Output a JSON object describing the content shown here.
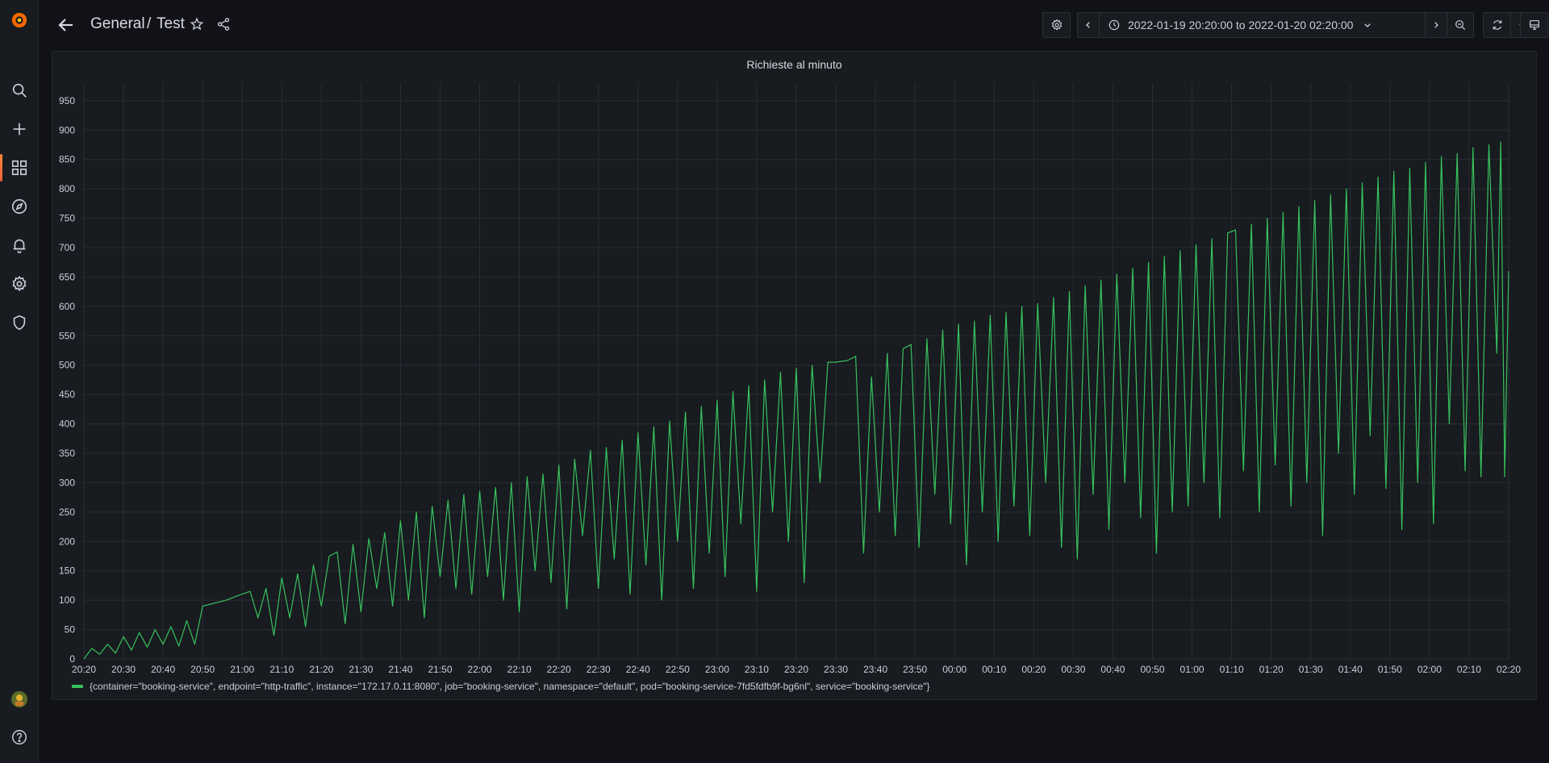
{
  "breadcrumb": {
    "folder": "General",
    "separator": "/",
    "dashboard": "Test"
  },
  "time_range": {
    "label": "2022-01-19 20:20:00 to 2022-01-20 02:20:00"
  },
  "panel": {
    "title": "Richieste al minuto"
  },
  "colors": {
    "series": "#37c15e",
    "brand_orange": "#f55f3e",
    "background": "#111217",
    "panel_bg": "#181b1f"
  },
  "icons": {
    "sidebar": [
      "grafana-logo-icon",
      "search-icon",
      "plus-icon",
      "dashboards-icon",
      "explore-compass-icon",
      "bell-icon",
      "gear-icon",
      "shield-icon",
      "avatar",
      "help-icon"
    ],
    "toolbar": [
      "arrow-left-icon",
      "star-icon",
      "share-icon",
      "gear-icon",
      "chevron-left-icon",
      "clock-icon",
      "chevron-down-icon",
      "chevron-right-icon",
      "zoom-out-icon",
      "refresh-icon",
      "monitor-icon"
    ]
  },
  "chart_data": {
    "type": "line",
    "title": "Richieste al minuto",
    "xlabel": "",
    "ylabel": "",
    "ylim": [
      0,
      980
    ],
    "yticks": [
      "0",
      "50",
      "100",
      "150",
      "200",
      "250",
      "300",
      "350",
      "400",
      "450",
      "500",
      "550",
      "600",
      "650",
      "700",
      "750",
      "800",
      "850",
      "900",
      "950"
    ],
    "xlim": [
      "2022-01-19 20:20",
      "2022-01-20 02:20"
    ],
    "xticks": [
      "20:20",
      "20:30",
      "20:40",
      "20:50",
      "21:00",
      "21:10",
      "21:20",
      "21:30",
      "21:40",
      "21:50",
      "22:00",
      "22:10",
      "22:20",
      "22:30",
      "22:40",
      "22:50",
      "23:00",
      "23:10",
      "23:20",
      "23:30",
      "23:40",
      "23:50",
      "00:00",
      "00:10",
      "00:20",
      "00:30",
      "00:40",
      "00:50",
      "01:00",
      "01:10",
      "01:20",
      "01:30",
      "01:40",
      "01:50",
      "02:00",
      "02:10",
      "02:20"
    ],
    "grid": true,
    "legend": "bottom",
    "series": [
      {
        "name": "{container=\"booking-service\", endpoint=\"http-traffic\", instance=\"172.17.0.11:8080\", job=\"booking-service\", namespace=\"default\", pod=\"booking-service-7fd5fdfb9f-bg6nl\", service=\"booking-service\"}",
        "color": "#37c15e",
        "points": [
          [
            "2022-01-19 20:20",
            0
          ],
          [
            "2022-01-19 20:22",
            18
          ],
          [
            "2022-01-19 20:24",
            8
          ],
          [
            "2022-01-19 20:26",
            25
          ],
          [
            "2022-01-19 20:28",
            10
          ],
          [
            "2022-01-19 20:30",
            38
          ],
          [
            "2022-01-19 20:32",
            15
          ],
          [
            "2022-01-19 20:34",
            45
          ],
          [
            "2022-01-19 20:36",
            20
          ],
          [
            "2022-01-19 20:38",
            50
          ],
          [
            "2022-01-19 20:40",
            25
          ],
          [
            "2022-01-19 20:42",
            55
          ],
          [
            "2022-01-19 20:44",
            22
          ],
          [
            "2022-01-19 20:46",
            65
          ],
          [
            "2022-01-19 20:48",
            25
          ],
          [
            "2022-01-19 20:50",
            90
          ],
          [
            "2022-01-19 20:53",
            95
          ],
          [
            "2022-01-19 20:56",
            100
          ],
          [
            "2022-01-19 20:59",
            108
          ],
          [
            "2022-01-19 21:02",
            115
          ],
          [
            "2022-01-19 21:04",
            70
          ],
          [
            "2022-01-19 21:06",
            120
          ],
          [
            "2022-01-19 21:08",
            40
          ],
          [
            "2022-01-19 21:10",
            138
          ],
          [
            "2022-01-19 21:12",
            70
          ],
          [
            "2022-01-19 21:14",
            145
          ],
          [
            "2022-01-19 21:16",
            55
          ],
          [
            "2022-01-19 21:18",
            160
          ],
          [
            "2022-01-19 21:20",
            90
          ],
          [
            "2022-01-19 21:22",
            175
          ],
          [
            "2022-01-19 21:24",
            182
          ],
          [
            "2022-01-19 21:26",
            60
          ],
          [
            "2022-01-19 21:28",
            195
          ],
          [
            "2022-01-19 21:30",
            80
          ],
          [
            "2022-01-19 21:32",
            205
          ],
          [
            "2022-01-19 21:34",
            120
          ],
          [
            "2022-01-19 21:36",
            215
          ],
          [
            "2022-01-19 21:38",
            90
          ],
          [
            "2022-01-19 21:40",
            235
          ],
          [
            "2022-01-19 21:42",
            100
          ],
          [
            "2022-01-19 21:44",
            250
          ],
          [
            "2022-01-19 21:46",
            70
          ],
          [
            "2022-01-19 21:48",
            260
          ],
          [
            "2022-01-19 21:50",
            140
          ],
          [
            "2022-01-19 21:52",
            270
          ],
          [
            "2022-01-19 21:54",
            120
          ],
          [
            "2022-01-19 21:56",
            280
          ],
          [
            "2022-01-19 21:58",
            110
          ],
          [
            "2022-01-19 22:00",
            285
          ],
          [
            "2022-01-19 22:02",
            140
          ],
          [
            "2022-01-19 22:04",
            292
          ],
          [
            "2022-01-19 22:06",
            100
          ],
          [
            "2022-01-19 22:08",
            300
          ],
          [
            "2022-01-19 22:10",
            80
          ],
          [
            "2022-01-19 22:12",
            310
          ],
          [
            "2022-01-19 22:14",
            150
          ],
          [
            "2022-01-19 22:16",
            315
          ],
          [
            "2022-01-19 22:18",
            130
          ],
          [
            "2022-01-19 22:20",
            330
          ],
          [
            "2022-01-19 22:22",
            85
          ],
          [
            "2022-01-19 22:24",
            340
          ],
          [
            "2022-01-19 22:26",
            210
          ],
          [
            "2022-01-19 22:28",
            355
          ],
          [
            "2022-01-19 22:30",
            120
          ],
          [
            "2022-01-19 22:32",
            360
          ],
          [
            "2022-01-19 22:34",
            170
          ],
          [
            "2022-01-19 22:36",
            372
          ],
          [
            "2022-01-19 22:38",
            110
          ],
          [
            "2022-01-19 22:40",
            385
          ],
          [
            "2022-01-19 22:42",
            160
          ],
          [
            "2022-01-19 22:44",
            395
          ],
          [
            "2022-01-19 22:46",
            100
          ],
          [
            "2022-01-19 22:48",
            405
          ],
          [
            "2022-01-19 22:50",
            200
          ],
          [
            "2022-01-19 22:52",
            420
          ],
          [
            "2022-01-19 22:54",
            120
          ],
          [
            "2022-01-19 22:56",
            430
          ],
          [
            "2022-01-19 22:58",
            180
          ],
          [
            "2022-01-19 23:00",
            440
          ],
          [
            "2022-01-19 23:02",
            140
          ],
          [
            "2022-01-19 23:04",
            455
          ],
          [
            "2022-01-19 23:06",
            230
          ],
          [
            "2022-01-19 23:08",
            465
          ],
          [
            "2022-01-19 23:10",
            115
          ],
          [
            "2022-01-19 23:12",
            475
          ],
          [
            "2022-01-19 23:14",
            250
          ],
          [
            "2022-01-19 23:16",
            488
          ],
          [
            "2022-01-19 23:18",
            200
          ],
          [
            "2022-01-19 23:20",
            495
          ],
          [
            "2022-01-19 23:22",
            130
          ],
          [
            "2022-01-19 23:24",
            500
          ],
          [
            "2022-01-19 23:26",
            300
          ],
          [
            "2022-01-19 23:28",
            505
          ],
          [
            "2022-01-19 23:30",
            505
          ],
          [
            "2022-01-19 23:33",
            508
          ],
          [
            "2022-01-19 23:35",
            515
          ],
          [
            "2022-01-19 23:37",
            180
          ],
          [
            "2022-01-19 23:39",
            480
          ],
          [
            "2022-01-19 23:41",
            250
          ],
          [
            "2022-01-19 23:43",
            520
          ],
          [
            "2022-01-19 23:45",
            210
          ],
          [
            "2022-01-19 23:47",
            528
          ],
          [
            "2022-01-19 23:49",
            535
          ],
          [
            "2022-01-19 23:51",
            190
          ],
          [
            "2022-01-19 23:53",
            545
          ],
          [
            "2022-01-19 23:55",
            280
          ],
          [
            "2022-01-19 23:57",
            560
          ],
          [
            "2022-01-19 23:59",
            230
          ],
          [
            "2022-01-20 00:01",
            570
          ],
          [
            "2022-01-20 00:03",
            160
          ],
          [
            "2022-01-20 00:05",
            575
          ],
          [
            "2022-01-20 00:07",
            250
          ],
          [
            "2022-01-20 00:09",
            585
          ],
          [
            "2022-01-20 00:11",
            200
          ],
          [
            "2022-01-20 00:13",
            590
          ],
          [
            "2022-01-20 00:15",
            260
          ],
          [
            "2022-01-20 00:17",
            600
          ],
          [
            "2022-01-20 00:19",
            210
          ],
          [
            "2022-01-20 00:21",
            605
          ],
          [
            "2022-01-20 00:23",
            300
          ],
          [
            "2022-01-20 00:25",
            615
          ],
          [
            "2022-01-20 00:27",
            190
          ],
          [
            "2022-01-20 00:29",
            625
          ],
          [
            "2022-01-20 00:31",
            170
          ],
          [
            "2022-01-20 00:33",
            635
          ],
          [
            "2022-01-20 00:35",
            280
          ],
          [
            "2022-01-20 00:37",
            645
          ],
          [
            "2022-01-20 00:39",
            220
          ],
          [
            "2022-01-20 00:41",
            655
          ],
          [
            "2022-01-20 00:43",
            300
          ],
          [
            "2022-01-20 00:45",
            665
          ],
          [
            "2022-01-20 00:47",
            240
          ],
          [
            "2022-01-20 00:49",
            675
          ],
          [
            "2022-01-20 00:51",
            180
          ],
          [
            "2022-01-20 00:53",
            685
          ],
          [
            "2022-01-20 00:55",
            250
          ],
          [
            "2022-01-20 00:57",
            695
          ],
          [
            "2022-01-20 00:59",
            260
          ],
          [
            "2022-01-20 01:01",
            705
          ],
          [
            "2022-01-20 01:03",
            300
          ],
          [
            "2022-01-20 01:05",
            715
          ],
          [
            "2022-01-20 01:07",
            240
          ],
          [
            "2022-01-20 01:09",
            725
          ],
          [
            "2022-01-20 01:11",
            730
          ],
          [
            "2022-01-20 01:13",
            320
          ],
          [
            "2022-01-20 01:15",
            740
          ],
          [
            "2022-01-20 01:17",
            250
          ],
          [
            "2022-01-20 01:19",
            750
          ],
          [
            "2022-01-20 01:21",
            330
          ],
          [
            "2022-01-20 01:23",
            760
          ],
          [
            "2022-01-20 01:25",
            260
          ],
          [
            "2022-01-20 01:27",
            770
          ],
          [
            "2022-01-20 01:29",
            300
          ],
          [
            "2022-01-20 01:31",
            780
          ],
          [
            "2022-01-20 01:33",
            210
          ],
          [
            "2022-01-20 01:35",
            790
          ],
          [
            "2022-01-20 01:37",
            350
          ],
          [
            "2022-01-20 01:39",
            800
          ],
          [
            "2022-01-20 01:41",
            280
          ],
          [
            "2022-01-20 01:43",
            810
          ],
          [
            "2022-01-20 01:45",
            380
          ],
          [
            "2022-01-20 01:47",
            820
          ],
          [
            "2022-01-20 01:49",
            290
          ],
          [
            "2022-01-20 01:51",
            830
          ],
          [
            "2022-01-20 01:53",
            220
          ],
          [
            "2022-01-20 01:55",
            835
          ],
          [
            "2022-01-20 01:57",
            300
          ],
          [
            "2022-01-20 01:59",
            845
          ],
          [
            "2022-01-20 02:01",
            230
          ],
          [
            "2022-01-20 02:03",
            855
          ],
          [
            "2022-01-20 02:05",
            400
          ],
          [
            "2022-01-20 02:07",
            860
          ],
          [
            "2022-01-20 02:09",
            320
          ],
          [
            "2022-01-20 02:11",
            870
          ],
          [
            "2022-01-20 02:13",
            310
          ],
          [
            "2022-01-20 02:15",
            875
          ],
          [
            "2022-01-20 02:17",
            520
          ],
          [
            "2022-01-20 02:18",
            880
          ],
          [
            "2022-01-20 02:19",
            310
          ],
          [
            "2022-01-20 02:20",
            660
          ]
        ]
      }
    ]
  }
}
